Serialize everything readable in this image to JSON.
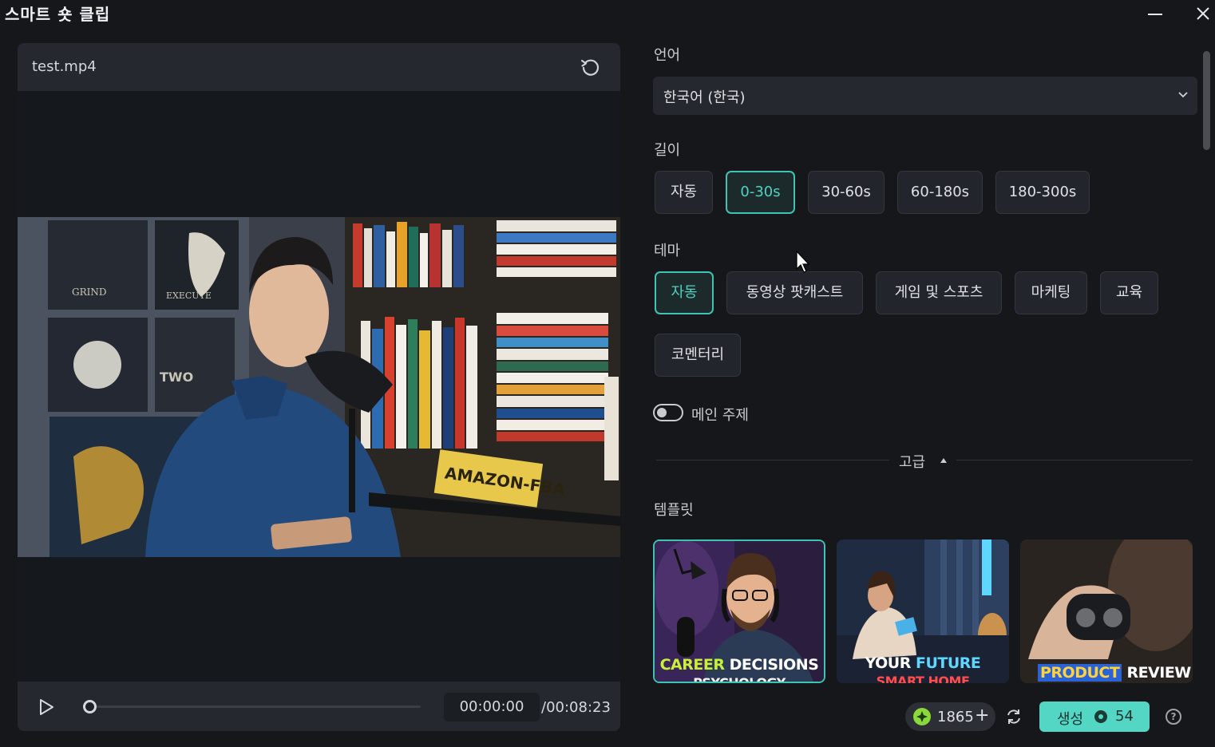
{
  "window": {
    "title": "스마트 숏 클립"
  },
  "player": {
    "filename": "test.mp4",
    "current_time": "00:00:00",
    "total_time": "/00:08:23",
    "progress": 0
  },
  "settings": {
    "language_label": "언어",
    "language_value": "한국어 (한국)",
    "length_label": "길이",
    "length_options": [
      "자동",
      "0-30s",
      "30-60s",
      "60-180s",
      "180-300s"
    ],
    "length_selected": "0-30s",
    "theme_label": "테마",
    "theme_options": [
      "자동",
      "동영상 팟캐스트",
      "게임 및 스포츠",
      "마케팅",
      "교육",
      "코멘터리"
    ],
    "theme_selected": "자동",
    "main_topic_label": "메인 주제",
    "main_topic_enabled": false,
    "advanced_label": "고급",
    "template_label": "템플릿",
    "templates": [
      {
        "line1a": "CAREER",
        "line1b": "DECISIONS",
        "line2": "PSYCHOLOGY",
        "selected": true
      },
      {
        "line1a": "YOUR",
        "line1b": "FUTURE",
        "line2": "SMART HOME",
        "selected": false
      },
      {
        "line1a": "PRODUCT",
        "line1b": "REVIEW",
        "line2": "",
        "selected": false
      }
    ]
  },
  "footer": {
    "credits": "1865",
    "generate_label": "생성",
    "generate_cost": "54"
  },
  "colors": {
    "accent": "#53d6c4",
    "selected_border": "#3fc4b4",
    "background": "#15171b",
    "credit_icon": "#8ad83c"
  },
  "icons": [
    "minimize-icon",
    "close-icon",
    "refresh-icon",
    "play-icon",
    "chevron-down-icon",
    "caret-up-icon",
    "credit-icon",
    "plus-icon",
    "sync-icon",
    "coin-icon",
    "help-icon",
    "mouse-cursor-icon"
  ]
}
